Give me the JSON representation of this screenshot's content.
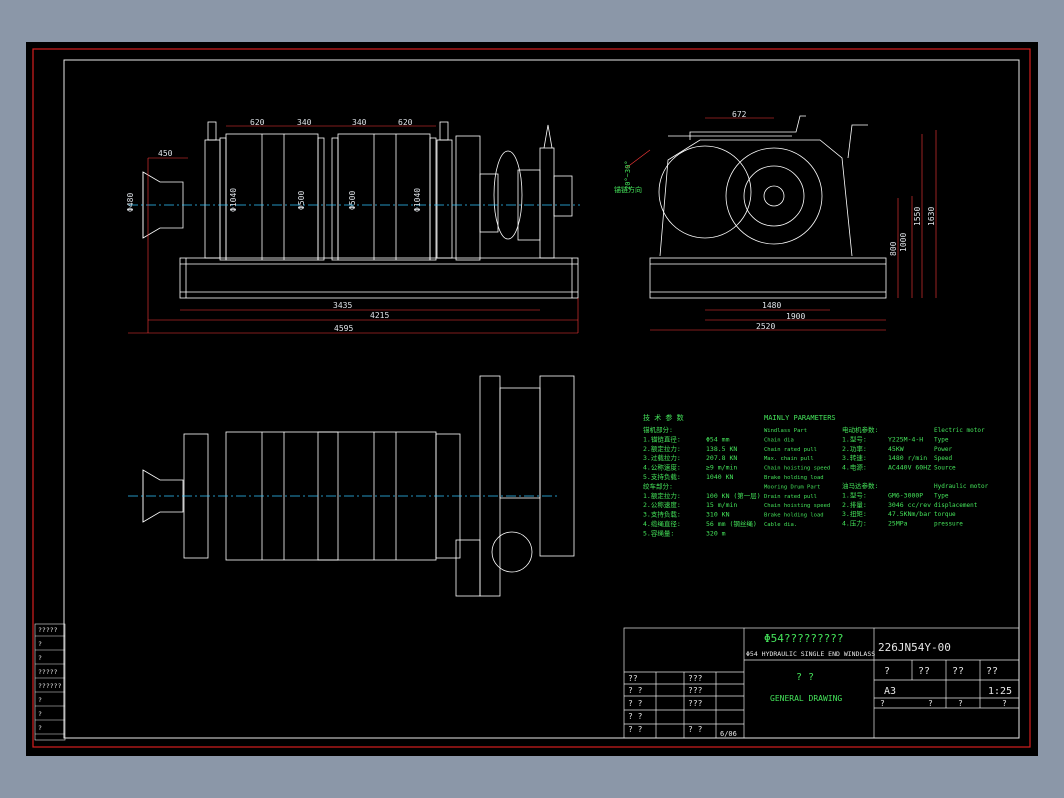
{
  "colors": {
    "viewport": "#8b97a8",
    "sheet": "#000000",
    "frame": "#d61e1e",
    "geometry": "#ffffff",
    "centerline": "#2fc6ff",
    "dimension": "#ff3a3a",
    "text_green": "#44e35a",
    "text_white": "#e6e6e6"
  },
  "elevation_dims": {
    "top": [
      "620",
      "340",
      "340",
      "620"
    ],
    "left_offset": "450",
    "bottom": [
      "3435",
      "4215",
      "4595"
    ],
    "vertical": [
      "Φ480",
      "Φ1040",
      "Φ500",
      "Φ500",
      "Φ1040"
    ]
  },
  "side_dims": {
    "top": "672",
    "bottom": [
      "1480",
      "1900",
      "2520"
    ],
    "right": [
      "1550",
      "1630",
      "1000",
      "800"
    ],
    "angle_note": "20°~30°",
    "hawse_label": "锚链方向"
  },
  "params": {
    "cn_title": "技 术 参 数",
    "en_title": "MAINLY PARAMETERS",
    "cn": [
      "锚机部分:",
      "1.锚链直径:",
      "2.额定拉力:",
      "3.过载拉力:",
      "4.公称速度:",
      "5.支持负载:",
      "绞车部分:",
      "1.额定拉力:",
      "2.公称速度:",
      "3.支持负载:",
      "4.缆绳直径:",
      "5.容绳量:"
    ],
    "values": [
      "",
      "Φ54 mm",
      "138.5 KN",
      "207.8 KN",
      "≥9 m/min",
      "1040 KN",
      "",
      "100 KN (第一层)",
      "15 m/min",
      "310 KN",
      "56 mm (钢丝绳)",
      "320 m"
    ],
    "en": [
      "Windlass Part",
      "Chain dia",
      "Chain rated pull",
      "Max. chain pull",
      "Chain hoisting speed",
      "Brake holding load",
      "Mooring Drum Part",
      "Drain rated pull",
      "Chain hoisting speed",
      "Brake holding load",
      "Cable dia.",
      ""
    ],
    "motor_cn": [
      "电动机参数:",
      "1.型号:",
      "2.功率:",
      "3.转速:",
      "4.电源:"
    ],
    "motor_val": [
      "",
      "Y225M-4-H",
      "45KW",
      "1480 r/min",
      "AC440V 60HZ"
    ],
    "motor_en": [
      "Electric motor",
      "Type",
      "Power",
      "Speed",
      "Source"
    ],
    "hyd_cn": [
      "油马达参数:",
      "1.型号:",
      "2.排量:",
      "3.扭矩:",
      "4.压力:"
    ],
    "hyd_val": [
      "",
      "GM6-3000P",
      "3046 cc/rev",
      "47.5KNm/bar",
      "25MPa"
    ],
    "hyd_en": [
      "Hydraulic motor",
      "Type",
      "displacement",
      "torque",
      "pressure"
    ]
  },
  "side_table": [
    "?????",
    "?",
    "?",
    "?????",
    "??????",
    "?",
    "?",
    "?"
  ],
  "title_block": {
    "name_cn": "Φ54?????????",
    "name_en": "Φ54 HYDRAULIC SINGLE END WINDLASS",
    "drawing_no": "226JN54Y-00",
    "heads": [
      "?",
      "??",
      "??",
      "??"
    ],
    "view_cn": "? ?",
    "view_en": "GENERAL DRAWING",
    "size": "A3",
    "scale": "1:25",
    "bottom": [
      "?",
      "?",
      "?",
      "?"
    ],
    "rows": [
      [
        "? ?",
        "",
        "???",
        "",
        "??",
        "???"
      ],
      [
        "? ?",
        "",
        "???",
        "",
        "",
        ""
      ],
      [
        "? ?",
        "",
        "",
        "",
        "",
        ""
      ],
      [
        "? ?",
        "",
        "? ?",
        "",
        "",
        ""
      ]
    ],
    "date": "6/06"
  }
}
